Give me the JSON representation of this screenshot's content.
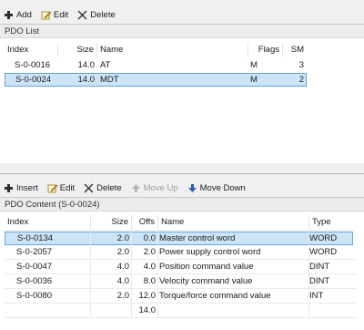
{
  "top_toolbar": {
    "add": "Add",
    "edit": "Edit",
    "delete": "Delete"
  },
  "pdo_list": {
    "title": "PDO List",
    "columns": [
      "Index",
      "Size",
      "Name",
      "Flags",
      "SM"
    ],
    "rows": [
      {
        "index": "S-0-0016",
        "size": "14.0",
        "name": "AT",
        "flags": "M",
        "sm": "3"
      },
      {
        "index": "S-0-0024",
        "size": "14.0",
        "name": "MDT",
        "flags": "M",
        "sm": "2"
      }
    ]
  },
  "content_toolbar": {
    "insert": "Insert",
    "edit": "Edit",
    "delete": "Delete",
    "move_up": "Move Up",
    "move_down": "Move Down"
  },
  "pdo_content": {
    "title": "PDO Content (S-0-0024)",
    "columns": [
      "Index",
      "Size",
      "Offs",
      "Name",
      "Type"
    ],
    "rows": [
      {
        "index": "S-0-0134",
        "size": "2.0",
        "offs": "0.0",
        "name": "Master control word",
        "type": "WORD"
      },
      {
        "index": "S-0-2057",
        "size": "2.0",
        "offs": "2.0",
        "name": "Power supply control word",
        "type": "WORD"
      },
      {
        "index": "S-0-0047",
        "size": "4.0",
        "offs": "4.0",
        "name": "Position command value",
        "type": "DINT"
      },
      {
        "index": "S-0-0036",
        "size": "4.0",
        "offs": "8.0",
        "name": "Velocity command value",
        "type": "DINT"
      },
      {
        "index": "S-0-0080",
        "size": "2.0",
        "offs": "12.0",
        "name": "Torque/force command value",
        "type": "INT"
      }
    ],
    "total_offs": "14.0"
  },
  "colors": {
    "selection": "#cce4f7",
    "selection_border": "#6aa4d9",
    "add_icon": "#2e2e2e",
    "move_down_icon": "#2d5fb0"
  }
}
